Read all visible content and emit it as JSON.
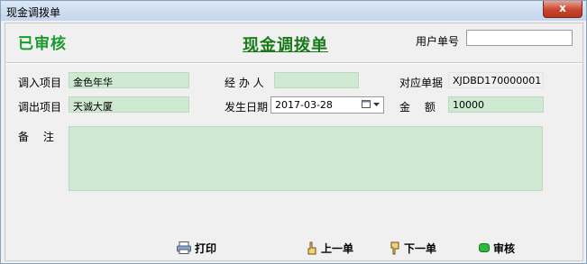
{
  "window": {
    "title": "现金调拨单",
    "close_glyph": "x"
  },
  "header": {
    "status_stamp": "已审核",
    "form_title": "现金调拨单",
    "user_no_label": "用户单号",
    "user_no_value": ""
  },
  "fields": {
    "in_project_label": "调入项目",
    "in_project_value": "金色年华",
    "handler_label": "经 办 人",
    "handler_value": "",
    "ref_no_label": "对应单据",
    "ref_no_value": "XJDBD170000001",
    "out_project_label": "调出项目",
    "out_project_value": "天诚大厦",
    "date_label": "发生日期",
    "date_value": "2017-03-28",
    "amount_label": "金　 额",
    "amount_value": "10000",
    "remarks_label": "备　 注",
    "remarks_value": ""
  },
  "toolbar": {
    "print_label": "打印",
    "prev_label": "上一单",
    "next_label": "下一单",
    "audit_label": "审核"
  },
  "colors": {
    "field_bg": "#cfe9d2",
    "stamp": "#1b9a2e",
    "title": "#1a7a1a"
  }
}
